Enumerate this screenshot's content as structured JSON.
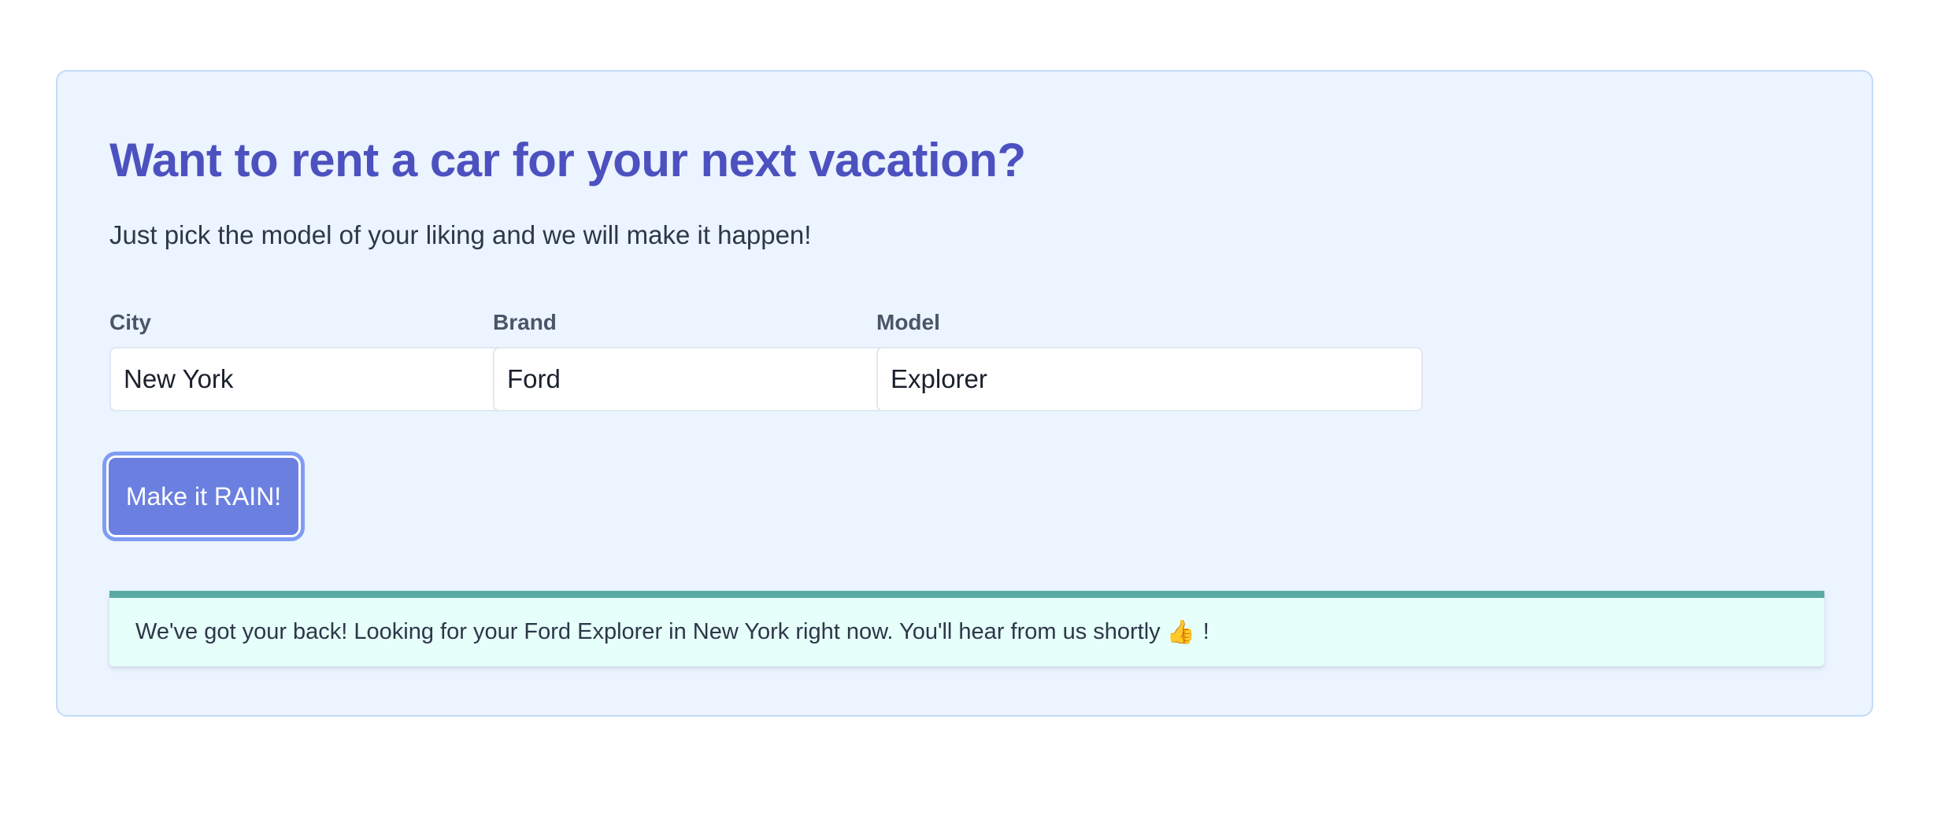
{
  "header": {
    "title": "Want to rent a car for your next vacation?",
    "subtitle": "Just pick the model of your liking and we will make it happen!"
  },
  "form": {
    "city": {
      "label": "City",
      "value": "New York"
    },
    "brand": {
      "label": "Brand",
      "value": "Ford"
    },
    "model": {
      "label": "Model",
      "value": "Explorer"
    },
    "submit_label": "Make it RAIN!"
  },
  "alert": {
    "message": "We've got your back! Looking for your Ford Explorer in New York right now. You'll hear from us shortly",
    "emoji": "👍",
    "suffix": "!"
  },
  "colors": {
    "title": "#4c51bf",
    "button": "#6b7fe0",
    "card_background": "#ebf4ff",
    "alert_background": "#e6fffa",
    "alert_border": "#5aaba1"
  },
  "icons": {
    "alert_emoji": "thumbs-up-icon"
  }
}
